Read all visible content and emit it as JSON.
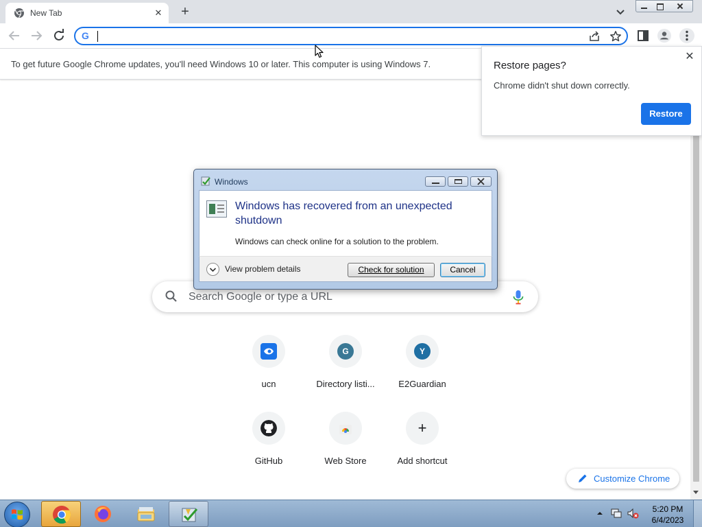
{
  "browser": {
    "tab": {
      "title": "New Tab",
      "favicon": "chrome-icon",
      "close_icon": "close-icon"
    },
    "new_tab_icon": "plus-icon",
    "tab_search_icon": "chevron-down-icon",
    "toolbar": {
      "back_icon": "arrow-left-icon",
      "forward_icon": "arrow-right-icon",
      "reload_icon": "reload-icon",
      "omnibox_value": "",
      "omnibox_g": "G",
      "share_icon": "share-icon",
      "bookmark_icon": "star-icon",
      "side_panel_icon": "side-panel-icon",
      "profile_icon": "person-icon",
      "menu_icon": "kebab-menu-icon"
    },
    "infobar_text": "To get future Google Chrome updates, you'll need Windows 10 or later. This computer is using Windows 7.",
    "accent_color": "#1a73e8"
  },
  "restore_bubble": {
    "title": "Restore pages?",
    "message": "Chrome didn't shut down correctly.",
    "button": "Restore",
    "close_glyph": "✕"
  },
  "ntp": {
    "search_placeholder": "Search Google or type a URL",
    "shortcuts": [
      {
        "label": "ucn",
        "icon": "ucn-icon",
        "letter": "",
        "color": "#1a73e8"
      },
      {
        "label": "Directory listi...",
        "icon": "letter-g-icon",
        "letter": "G",
        "color": "#3a7895"
      },
      {
        "label": "E2Guardian",
        "icon": "letter-y-icon",
        "letter": "Y",
        "color": "#1f6fa3"
      },
      {
        "label": "GitHub",
        "icon": "github-icon",
        "letter": "",
        "color": "#202124"
      },
      {
        "label": "Web Store",
        "icon": "web-store-icon",
        "letter": "",
        "color": "#ea4335"
      },
      {
        "label": "Add shortcut",
        "icon": "plus-icon",
        "letter": "+",
        "color": "#202124"
      }
    ],
    "customize_label": "Customize Chrome"
  },
  "dialog": {
    "window_title": "Windows",
    "heading": "Windows has recovered from an unexpected shutdown",
    "message": "Windows can check online for a solution to the problem.",
    "details_label": "View problem details",
    "check_button": "Check for solution",
    "cancel_button": "Cancel"
  },
  "taskbar": {
    "apps": [
      "chrome-icon",
      "firefox-icon",
      "file-explorer-icon",
      "action-center-icon"
    ],
    "active_app": "chrome-icon",
    "time": "5:20 PM",
    "date": "6/4/2023"
  }
}
